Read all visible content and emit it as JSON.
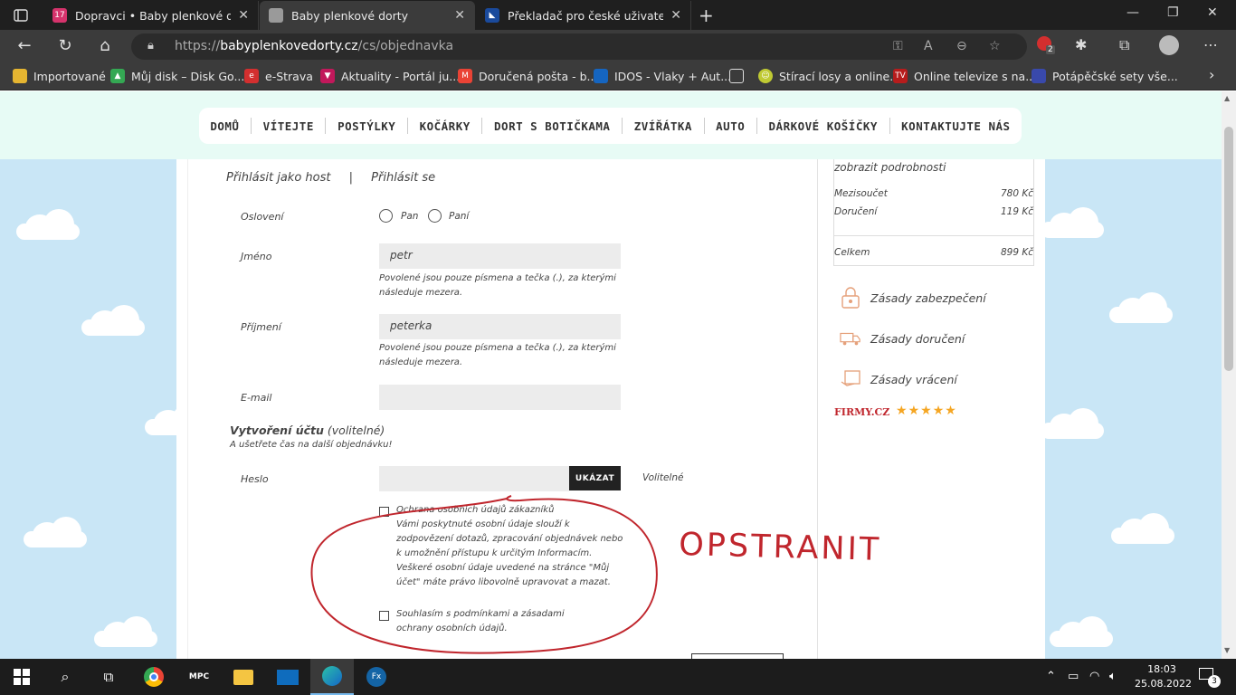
{
  "browser": {
    "tabs": [
      {
        "title": "Dopravci • Baby plenkové dorty",
        "favicon_text": "17",
        "favicon_color": "#d6336c"
      },
      {
        "title": "Baby plenkové dorty",
        "favicon_text": "",
        "favicon_color": "#9a9a9a"
      },
      {
        "title": "Překladač pro české uživatele | Č",
        "favicon_text": "",
        "favicon_color": "#1a4a9c"
      }
    ],
    "url_prefix": "https://",
    "url_domain": "babyplenkovedorty.cz",
    "url_path": "/cs/objednavka",
    "extension_badge": "2",
    "bookmarks": [
      {
        "label": "Importované",
        "icon_color": "#e5b531"
      },
      {
        "label": "Můj disk – Disk Go...",
        "icon_color": "#34a853"
      },
      {
        "label": "e-Strava",
        "icon_color": "#d32f2f"
      },
      {
        "label": "Aktuality - Portál ju...",
        "icon_color": "#c2185b"
      },
      {
        "label": "Doručená pošta - b...",
        "icon_color": "#ea4335"
      },
      {
        "label": "IDOS - Vlaky + Aut...",
        "icon_color": "#1565c0"
      },
      {
        "label": "Stírací losy a online...",
        "icon_color": "#c0ca33"
      },
      {
        "label": "Online televize s na...",
        "icon_color": "#b71c1c"
      },
      {
        "label": "Potápěčské sety vše...",
        "icon_color": "#3949ab"
      }
    ]
  },
  "site": {
    "nav": [
      "DOMŮ",
      "VÍTEJTE",
      "POSTÝLKY",
      "KOČÁRKY",
      "DORT S BOTIČKAMA",
      "ZVÍŘÁTKA",
      "AUTO",
      "DÁRKOVÉ KOŠÍČKY",
      "KONTAKTUJTE NÁS"
    ]
  },
  "form": {
    "login_guest": "Přihlásit jako host",
    "login_sep": "|",
    "login_signin": "Přihlásit se",
    "salutation_label": "Oslovení",
    "salutation_options": [
      "Pan",
      "Paní"
    ],
    "first_name_label": "Jméno",
    "first_name_value": "petr",
    "name_help": "Povolené jsou pouze písmena a tečka (.), za kterými následuje mezera.",
    "last_name_label": "Příjmení",
    "last_name_value": "peterka",
    "email_label": "E-mail",
    "account_title": "Vytvoření účtu",
    "account_optional": "(volitelné)",
    "account_subtitle": "A ušetřete čas na další objednávku!",
    "password_label": "Heslo",
    "show_button": "UKÁZAT",
    "password_optional": "Volitelné",
    "privacy_title": "Ochrana osobních údajů zákazníků",
    "privacy_text": "Vámi poskytnuté osobní údaje slouží k zodpovězení dotazů, zpracování objednávek nebo k umožnění přístupu k určitým Informacím. Veškeré osobní údaje uvedené na stránce \"Můj účet\" máte právo libovolně upravovat a mazat.",
    "consent_text": "Souhlasím s podmínkami a zásadami ochrany osobních údajů."
  },
  "summary": {
    "details_link": "zobrazit podrobnosti",
    "subtotal_label": "Mezisoučet",
    "subtotal_value": "780 Kč",
    "shipping_label": "Doručení",
    "shipping_value": "119 Kč",
    "total_label": "Celkem",
    "total_value": "899 Kč"
  },
  "policies": [
    "Zásady zabezpečení",
    "Zásady doručení",
    "Zásady vrácení"
  ],
  "firmy_logo": "FIRMY.CZ",
  "rating_stars": 5,
  "annotation": {
    "text": "OPSTRANIT",
    "color": "#c0262d"
  },
  "taskbar": {
    "time": "18:03",
    "date": "25.08.2022",
    "notification_count": "3"
  },
  "colors": {
    "sky": "#c9e6f6",
    "menu_band": "#e7fbf5",
    "accent_orange": "#f5a623"
  }
}
